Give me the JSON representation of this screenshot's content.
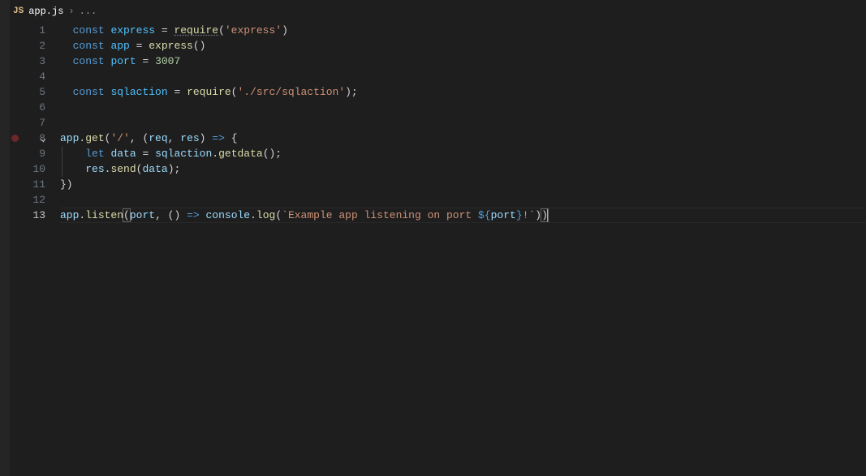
{
  "tab": {
    "icon_label": "JS",
    "filename": "app.js",
    "breadcrumb_rest": "..."
  },
  "line_numbers": [
    "1",
    "2",
    "3",
    "4",
    "5",
    "6",
    "7",
    "8",
    "9",
    "10",
    "11",
    "12",
    "13"
  ],
  "code": {
    "l1": {
      "kw": "const",
      "name": "express",
      "eq": " = ",
      "req": "require",
      "op1": "(",
      "s": "'express'",
      "op2": ")"
    },
    "l2": {
      "kw": "const",
      "name": "app",
      "eq": " = ",
      "fn": "express",
      "op": "()"
    },
    "l3": {
      "kw": "const",
      "name": "port",
      "eq": " = ",
      "num": "3007"
    },
    "l5": {
      "kw": "const",
      "name": "sqlaction",
      "eq": " = ",
      "req": "require",
      "op1": "(",
      "s": "'./src/sqlaction'",
      "op2": ");"
    },
    "l8": {
      "obj": "app",
      "dot": ".",
      "fn": "get",
      "op1": "(",
      "s": "'/'",
      "c": ", (",
      "p1": "req",
      "c2": ", ",
      "p2": "res",
      "op2": ") ",
      "arrow": "=>",
      "op3": " {"
    },
    "l9": {
      "kw": "let",
      "name": "data",
      "eq": " = ",
      "obj": "sqlaction",
      "dot": ".",
      "fn": "getdata",
      "op": "();"
    },
    "l10": {
      "obj": "res",
      "dot": ".",
      "fn": "send",
      "op1": "(",
      "arg": "data",
      "op2": ");"
    },
    "l11": {
      "op": "})"
    },
    "l13": {
      "obj": "app",
      "dot": ".",
      "fn": "listen",
      "op1": "(",
      "arg": "port",
      "c": ", () ",
      "arrow": "=>",
      "sp": " ",
      "cons": "console",
      "dot2": ".",
      "log": "log",
      "op2": "(",
      "tick1": "`",
      "msg": "Example app listening on port ",
      "dl1": "${",
      "var": "port",
      "dl2": "}",
      "msg2": "!",
      "tick2": "`",
      "op3": ")",
      "op4": ")"
    }
  }
}
